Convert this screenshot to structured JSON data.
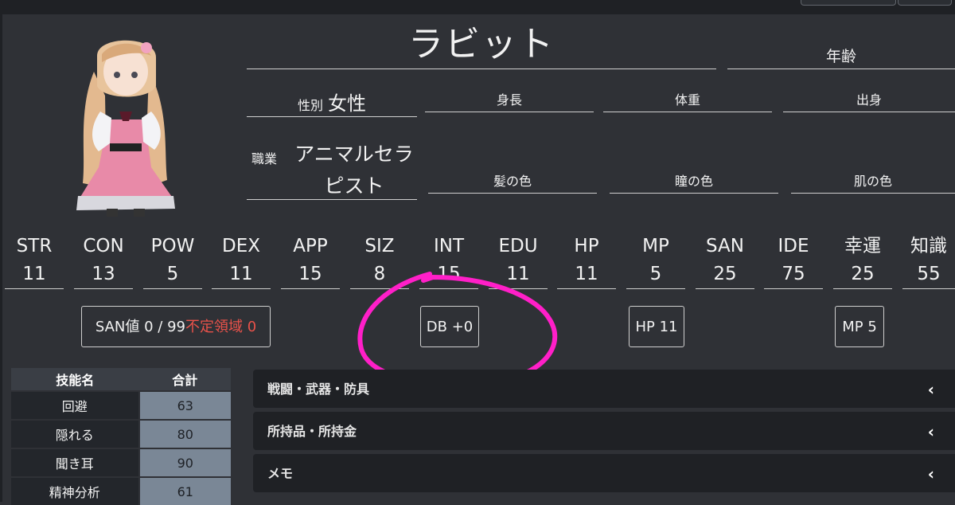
{
  "profile": {
    "name": "ラビット",
    "age_label": "年齢",
    "sex_label": "性別",
    "sex_value": "女性",
    "height_label": "身長",
    "weight_label": "体重",
    "origin_label": "出身",
    "job_label": "職業",
    "job_value": "アニマルセラピスト",
    "hair_label": "髪の色",
    "eye_label": "瞳の色",
    "skin_label": "肌の色"
  },
  "stats": [
    {
      "name": "STR",
      "value": "11"
    },
    {
      "name": "CON",
      "value": "13"
    },
    {
      "name": "POW",
      "value": "5"
    },
    {
      "name": "DEX",
      "value": "11"
    },
    {
      "name": "APP",
      "value": "15"
    },
    {
      "name": "SIZ",
      "value": "8"
    },
    {
      "name": "INT",
      "value": "15"
    },
    {
      "name": "EDU",
      "value": "11"
    },
    {
      "name": "HP",
      "value": "11"
    },
    {
      "name": "MP",
      "value": "5"
    },
    {
      "name": "SAN",
      "value": "25"
    },
    {
      "name": "IDE",
      "value": "75"
    },
    {
      "name": "幸運",
      "value": "25"
    },
    {
      "name": "知識",
      "value": "55"
    }
  ],
  "status": {
    "san": "SAN値 0 / 99",
    "indefinite": "不定領域 0",
    "db": "DB +0",
    "hp": "HP 11",
    "mp": "MP 5"
  },
  "skills": {
    "headers": [
      "技能名",
      "合計"
    ],
    "rows": [
      {
        "name": "回避",
        "total": "63"
      },
      {
        "name": "隠れる",
        "total": "80"
      },
      {
        "name": "聞き耳",
        "total": "90"
      },
      {
        "name": "精神分析",
        "total": "61"
      }
    ]
  },
  "sections": [
    "戦闘・武器・防具",
    "所持品・所持金",
    "メモ"
  ],
  "colors": {
    "background": "#2f3136",
    "accent_annotation": "#ff1fc8",
    "warning_red": "#e9524a"
  }
}
